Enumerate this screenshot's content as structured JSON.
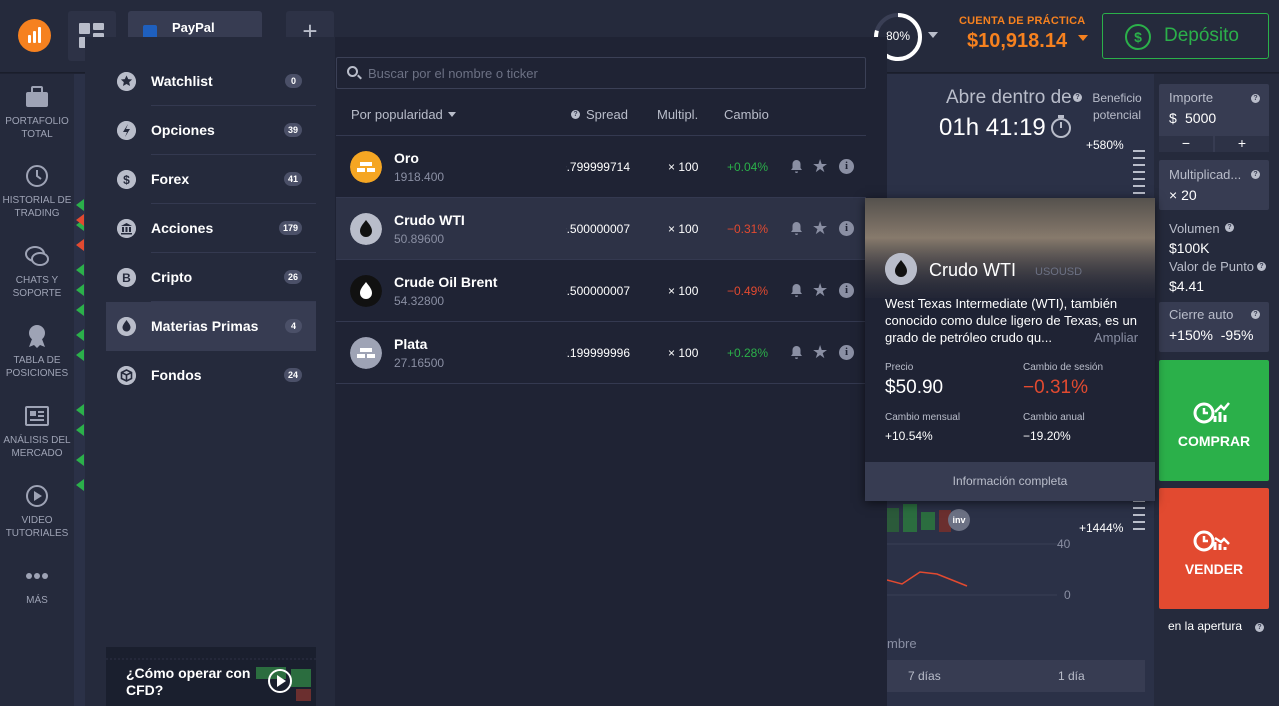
{
  "header": {
    "asset_tab_label": "PayPal",
    "add_tab_label": "+",
    "gauge_value": "80%",
    "account_label": "CUENTA DE PRÁCTICA",
    "account_balance": "$10,918.14",
    "deposit_label": "Depósito"
  },
  "left_nav": {
    "items": [
      {
        "label": "PORTAFOLIO TOTAL",
        "icon": "briefcase-icon"
      },
      {
        "label": "HISTORIAL DE TRADING",
        "icon": "history-icon"
      },
      {
        "label": "CHATS Y SOPORTE",
        "icon": "chat-icon"
      },
      {
        "label": "TABLA DE POSICIONES",
        "icon": "trophy-icon"
      },
      {
        "label": "ANÁLISIS DEL MERCADO",
        "icon": "news-icon"
      },
      {
        "label": "VIDEO TUTORIALES",
        "icon": "play-icon"
      },
      {
        "label": "MÁS",
        "icon": "more-icon"
      }
    ]
  },
  "categories": [
    {
      "label": "Watchlist",
      "count": "0",
      "icon": "star-icon"
    },
    {
      "label": "Opciones",
      "count": "39",
      "icon": "lightning-icon"
    },
    {
      "label": "Forex",
      "count": "41",
      "icon": "dollar-icon"
    },
    {
      "label": "Acciones",
      "count": "179",
      "icon": "bank-icon"
    },
    {
      "label": "Cripto",
      "count": "26",
      "icon": "bitcoin-icon"
    },
    {
      "label": "Materias Primas",
      "count": "4",
      "icon": "oil-drop-icon"
    },
    {
      "label": "Fondos",
      "count": "24",
      "icon": "box-icon"
    }
  ],
  "promo": {
    "text": "¿Cómo operar con CFD?"
  },
  "search": {
    "placeholder": "Buscar por el nombre o ticker"
  },
  "table": {
    "sort_label": "Por popularidad",
    "col_spread": "Spread",
    "col_mult": "Multipl.",
    "col_change": "Cambio",
    "rows": [
      {
        "name": "Oro",
        "price": "1918.400",
        "spread": "0.799999714",
        "mult": "× 100",
        "change": "+0.04%",
        "positive": true,
        "icon": "gold-bars-icon"
      },
      {
        "name": "Crudo WTI",
        "price": "50.89600",
        "spread": "0.500000007",
        "mult": "× 100",
        "change": "−0.31%",
        "positive": false,
        "icon": "oil-drop-icon"
      },
      {
        "name": "Crude Oil Brent",
        "price": "54.32800",
        "spread": "0.500000007",
        "mult": "× 100",
        "change": "−0.49%",
        "positive": false,
        "icon": "oil-drop-icon"
      },
      {
        "name": "Plata",
        "price": "27.16500",
        "spread": "0.199999996",
        "mult": "× 100",
        "change": "+0.28%",
        "positive": true,
        "icon": "silver-bars-icon"
      }
    ]
  },
  "info_card": {
    "name": "Crudo WTI",
    "ticker": "USOUSD",
    "description": "West Texas Intermediate (WTI), también conocido como dulce ligero de Texas, es un grado de petróleo crudo qu...",
    "more_label": "Ampliar",
    "price_label": "Precio",
    "price_value": "$50.90",
    "session_label": "Cambio de sesión",
    "session_value": "−0.31%",
    "monthly_label": "Cambio mensual",
    "monthly_value": "+10.54%",
    "annual_label": "Cambio anual",
    "annual_value": "−19.20%",
    "footer_label": "Información completa"
  },
  "chart": {
    "abre_label": "Abre dentro de",
    "countdown": "01h 41:19",
    "profit_label": "Beneficio potencial",
    "pct_top": "+580%",
    "pct_bottom": "+1444%",
    "axis_40": "40",
    "axis_0": "0",
    "month_fragment": "mbre",
    "period_7": "7 días",
    "period_1": "1 día",
    "inv_label": "inv"
  },
  "trade_panel": {
    "amount_label": "Importe",
    "amount_currency": "$",
    "amount_value": "5000",
    "minus": "−",
    "plus": "+",
    "multiplier_label": "Multiplicad...",
    "multiplier_value": "× 20",
    "volume_label": "Volumen",
    "volume_value": "$100K",
    "point_label": "Valor de Punto",
    "point_value": "$4.41",
    "autoclose_label": "Cierre auto",
    "autoclose_value": "+150%  -95%",
    "buy_label": "COMPRAR",
    "sell_label": "VENDER",
    "open_label": "en la apertura"
  },
  "colors": {
    "accent": "#f6811f",
    "positive": "#2bb04a",
    "negative": "#e24a30"
  }
}
